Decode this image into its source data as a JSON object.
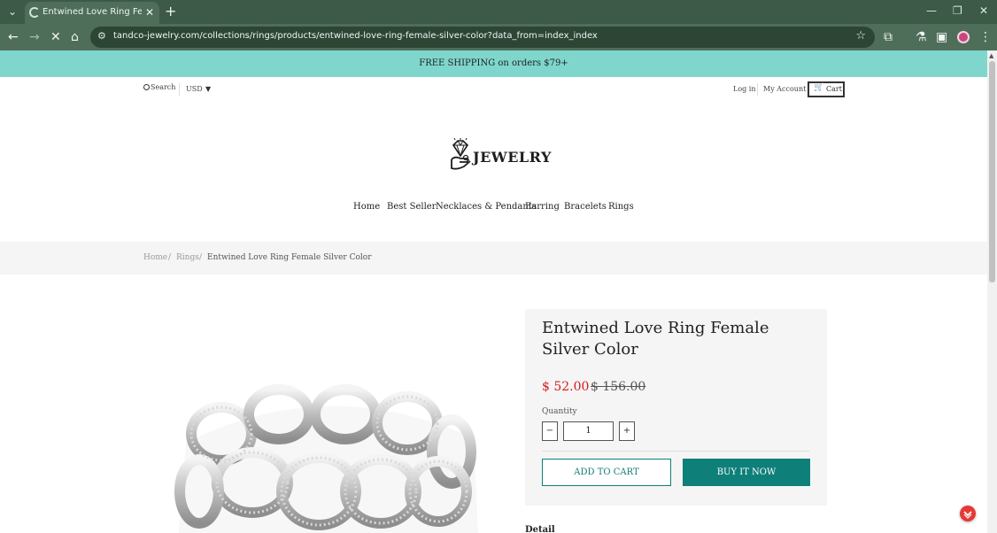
{
  "browser": {
    "tab_title": "Entwined Love Ring Female Silver Color",
    "url": "tandco-jewelry.com/collections/rings/products/entwined-love-ring-female-silver-color?data_from=index_index"
  },
  "announcement": "FREE SHIPPING on orders $79+",
  "utility": {
    "search_label": "Search",
    "currency": "USD",
    "login_label": "Log in",
    "account_label": "My Account",
    "cart_label": "Cart"
  },
  "logo": {
    "text": "JEWELRY"
  },
  "nav": {
    "items": [
      "Home",
      "Best Seller",
      "Necklaces & Pendants",
      "Earring",
      "Bracelets",
      "Rings"
    ]
  },
  "breadcrumb": {
    "items": [
      "Home",
      "Rings",
      "Entwined Love Ring Female Silver Color"
    ]
  },
  "product": {
    "title": "Entwined Love Ring Female Silver Color",
    "price": "$ 52.00",
    "compare_price": "$ 156.00",
    "quantity_label": "Quantity",
    "quantity": "1",
    "add_to_cart_label": "ADD TO CART",
    "buy_now_label": "BUY IT NOW",
    "detail_heading": "Detail"
  },
  "colors": {
    "announcement_bg": "#7fd6cd",
    "accent": "#0f7f79",
    "sale_price": "#d91a1a",
    "browser_frame": "#3c5a47"
  },
  "icons": [
    "chevron-down-icon",
    "close-icon",
    "plus-icon",
    "back-icon",
    "forward-icon",
    "stop-icon",
    "home-icon",
    "tune-icon",
    "star-icon",
    "extensions-icon",
    "labs-icon",
    "sidepanel-icon",
    "menu-icon",
    "search-icon",
    "cart-icon",
    "diamond-hand-icon",
    "minus-icon"
  ]
}
